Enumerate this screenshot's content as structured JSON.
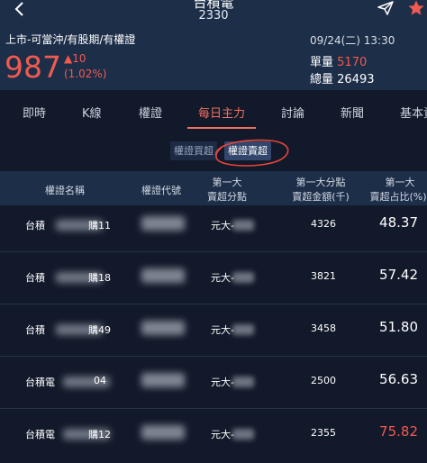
{
  "header": {
    "stock_name": "台積電",
    "stock_code": "2330",
    "market_tag": "上市-可當沖/有股期/有權證",
    "datetime": "09/24(二) 13:30",
    "price": "987",
    "change_abs": "10",
    "change_pct": "(1.02%)",
    "single_volume_label": "單量",
    "single_volume": "5170",
    "total_volume_label": "總量",
    "total_volume": "26493"
  },
  "tabs": [
    "即時",
    "K線",
    "權證",
    "每日主力",
    "討論",
    "新聞",
    "基本資"
  ],
  "active_tab": "每日主力",
  "segment": {
    "buy": "權證買超",
    "sell": "權證賣超"
  },
  "table": {
    "columns": {
      "name": "權證名稱",
      "code": "權證代號",
      "broker_1": "第一大",
      "broker_2": "賣超分點",
      "amount_1": "第一大分點",
      "amount_2": "賣超金額(千)",
      "ratio_1": "第一大",
      "ratio_2": "賣超占比(%)"
    },
    "rows": [
      {
        "name_prefix": "台積",
        "name_suffix": "購11",
        "broker": "元大-",
        "amount": "4326",
        "ratio": "48.37"
      },
      {
        "name_prefix": "台積",
        "name_suffix": "購18",
        "broker": "元大-",
        "amount": "3821",
        "ratio": "57.42"
      },
      {
        "name_prefix": "台積",
        "name_suffix": "購49",
        "broker": "元大-",
        "amount": "3458",
        "ratio": "51.80"
      },
      {
        "name_prefix": "台積電",
        "name_suffix": "04",
        "broker": "元大-",
        "amount": "2500",
        "ratio": "56.63"
      },
      {
        "name_prefix": "台積電",
        "name_suffix": "購12",
        "broker": "元大-",
        "amount": "2355",
        "ratio": "75.82"
      }
    ]
  },
  "colors": {
    "up": "#f05a4f",
    "accent": "#f0705f",
    "background": "#12192a",
    "header_bg": "#1d2e49"
  }
}
